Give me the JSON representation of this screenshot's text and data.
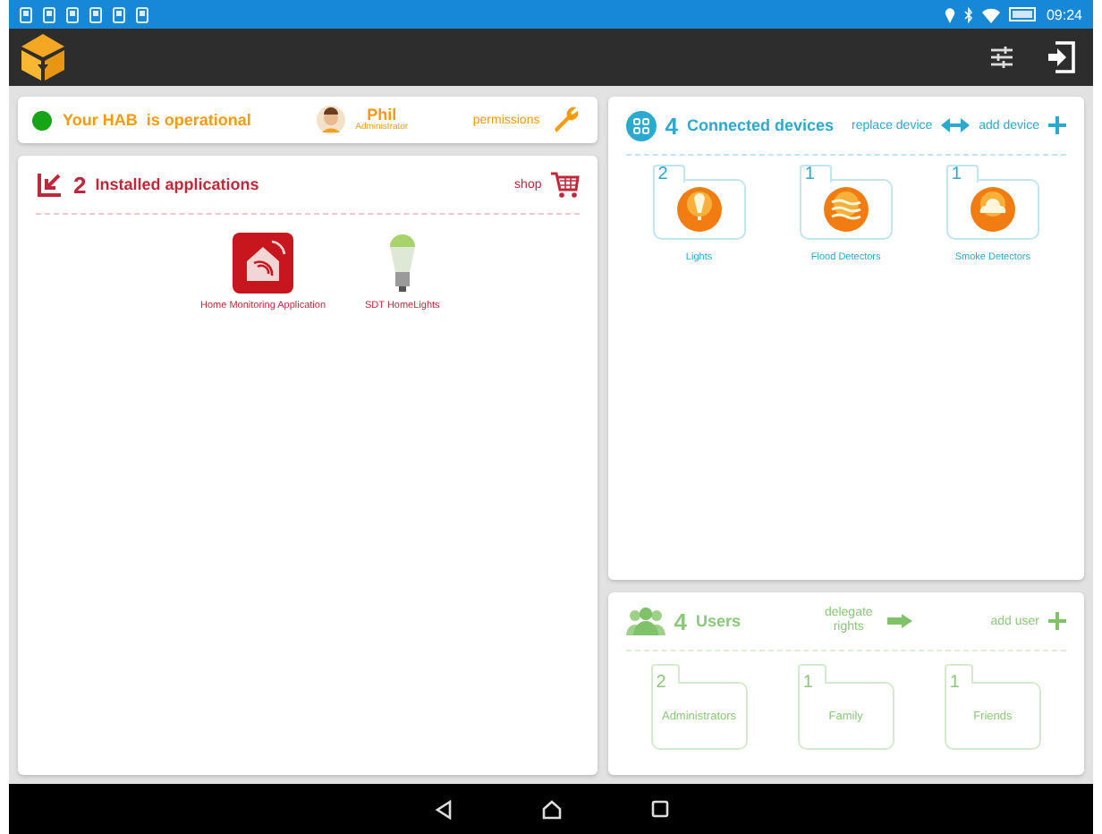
{
  "status_bar": {
    "time": "09:24"
  },
  "hab_status": {
    "operational": true,
    "text": "Your HAB  is operational",
    "user": {
      "name": "Phil",
      "role": "Administrator"
    },
    "permissions": "permissions"
  },
  "applications": {
    "count": "2",
    "title": "Installed applications",
    "shop": "shop",
    "items": [
      {
        "name": "Home Monitoring Application",
        "kind": "house"
      },
      {
        "name": "SDT HomeLights",
        "kind": "bulb"
      }
    ]
  },
  "devices": {
    "count": "4",
    "title": "Connected devices",
    "replace": "replace device",
    "add": "add device",
    "items": [
      {
        "count": "2",
        "name": "Lights",
        "kind": "light"
      },
      {
        "count": "1",
        "name": "Flood Detectors",
        "kind": "flood"
      },
      {
        "count": "1",
        "name": "Smoke Detectors",
        "kind": "smoke"
      }
    ]
  },
  "users": {
    "count": "4",
    "title": "Users",
    "delegate": "delegate rights",
    "add": "add user",
    "groups": [
      {
        "count": "2",
        "name": "Administrators"
      },
      {
        "count": "1",
        "name": "Family"
      },
      {
        "count": "1",
        "name": "Friends"
      }
    ]
  }
}
